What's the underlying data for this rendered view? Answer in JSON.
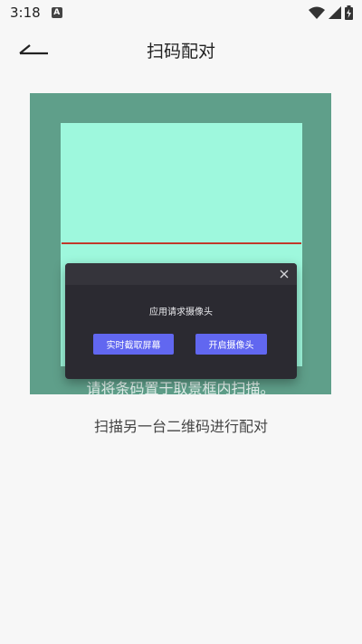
{
  "status_bar": {
    "time": "3:18",
    "notification_icon_letter": "A"
  },
  "header": {
    "title": "扫码配对"
  },
  "scanner": {
    "hint": "请将条码置于取景框内扫描。"
  },
  "pair_hint": "扫描另一台二维码进行配对",
  "dialog": {
    "message": "应用请求摄像头",
    "left_button": "实时截取屏幕",
    "right_button": "开启摄像头"
  },
  "colors": {
    "scanner_bg": "#5f9f8a",
    "scan_frame": "#9ef8dd",
    "scan_line": "#c0392b",
    "dialog_bg": "#2b2a31",
    "button_accent": "#6167f0"
  }
}
